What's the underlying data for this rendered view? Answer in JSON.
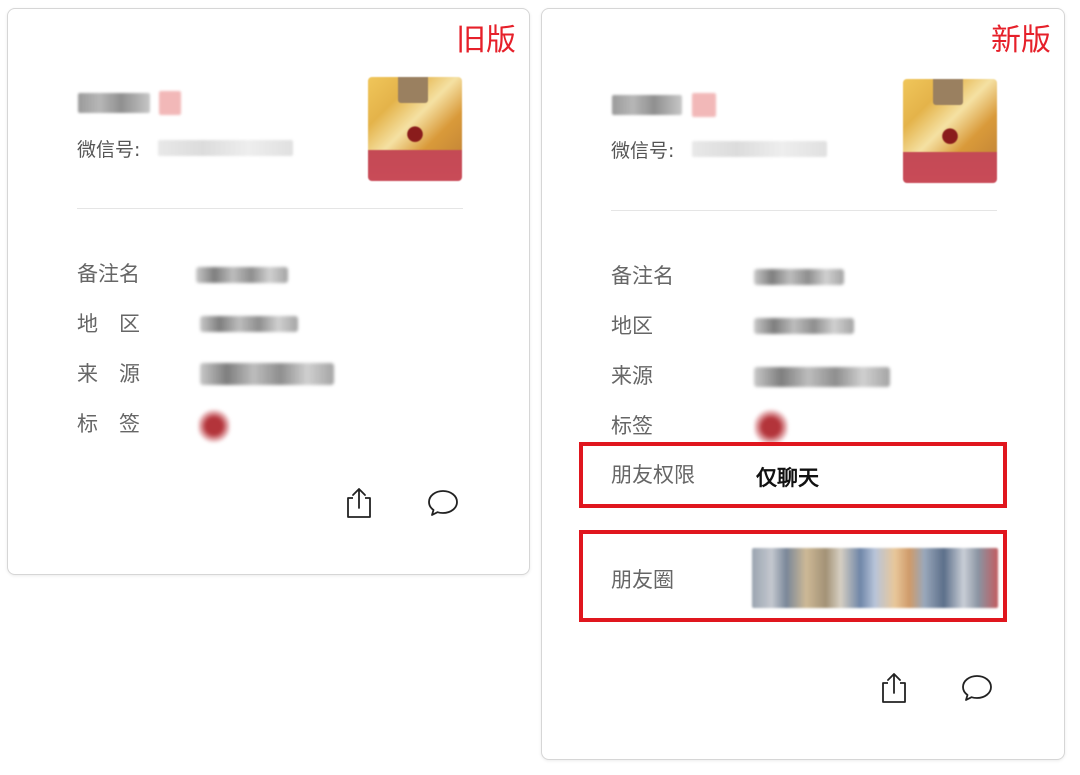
{
  "old_card": {
    "version_tag": "旧版",
    "wechat_id_label": "微信号:",
    "rows": [
      {
        "label": "备注名"
      },
      {
        "label": "地　区"
      },
      {
        "label": "来　源"
      },
      {
        "label": "标　签"
      }
    ]
  },
  "new_card": {
    "version_tag": "新版",
    "wechat_id_label": "微信号:",
    "rows": [
      {
        "label": "备注名"
      },
      {
        "label": "地区"
      },
      {
        "label": "来源"
      },
      {
        "label": "标签"
      }
    ],
    "friend_permission": {
      "label": "朋友权限",
      "value": "仅聊天"
    },
    "moments": {
      "label": "朋友圈"
    }
  },
  "icons": [
    "share-icon",
    "message-bubble-icon"
  ],
  "colors": {
    "highlight": "#e0161e",
    "version_tag": "#e6202a"
  }
}
